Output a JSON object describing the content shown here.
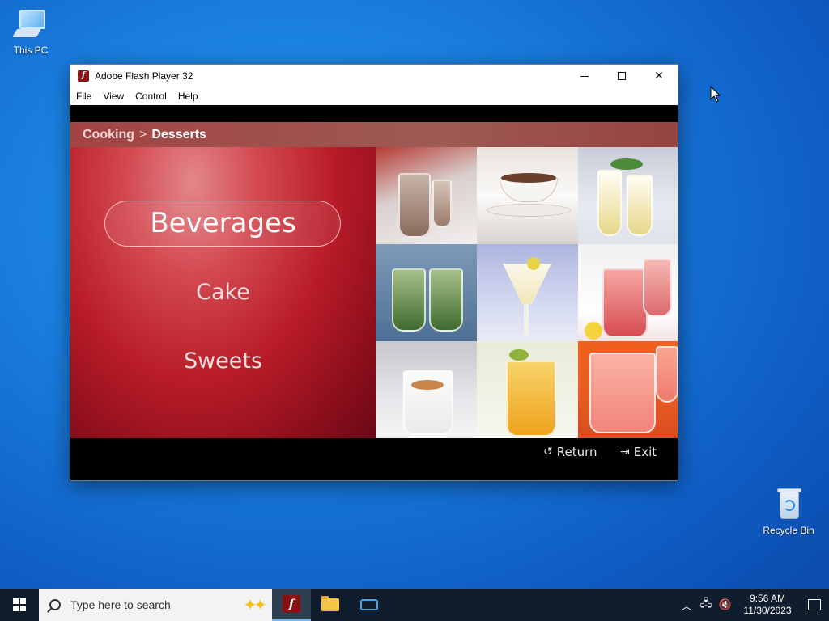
{
  "desktop": {
    "icons": [
      {
        "label": "This PC"
      },
      {
        "label": "Recycle Bin"
      }
    ]
  },
  "window": {
    "title": "Adobe Flash Player 32",
    "menu": [
      "File",
      "View",
      "Control",
      "Help"
    ],
    "controls": {
      "minimize": "minimize-icon",
      "maximize": "maximize-icon",
      "close": "close-icon"
    }
  },
  "flash": {
    "breadcrumb": {
      "root": "Cooking",
      "separator": ">",
      "current": "Desserts"
    },
    "categories": [
      {
        "label": "Beverages",
        "selected": true
      },
      {
        "label": "Cake",
        "selected": false
      },
      {
        "label": "Sweets",
        "selected": false
      }
    ],
    "buttons": {
      "return": "Return",
      "exit": "Exit"
    },
    "accent": "#b81c28"
  },
  "taskbar": {
    "search_placeholder": "Type here to search",
    "apps": [
      "flash-player-icon",
      "file-explorer-icon",
      "network-app-icon"
    ],
    "clock": {
      "time": "9:56 AM",
      "date": "11/30/2023"
    }
  }
}
